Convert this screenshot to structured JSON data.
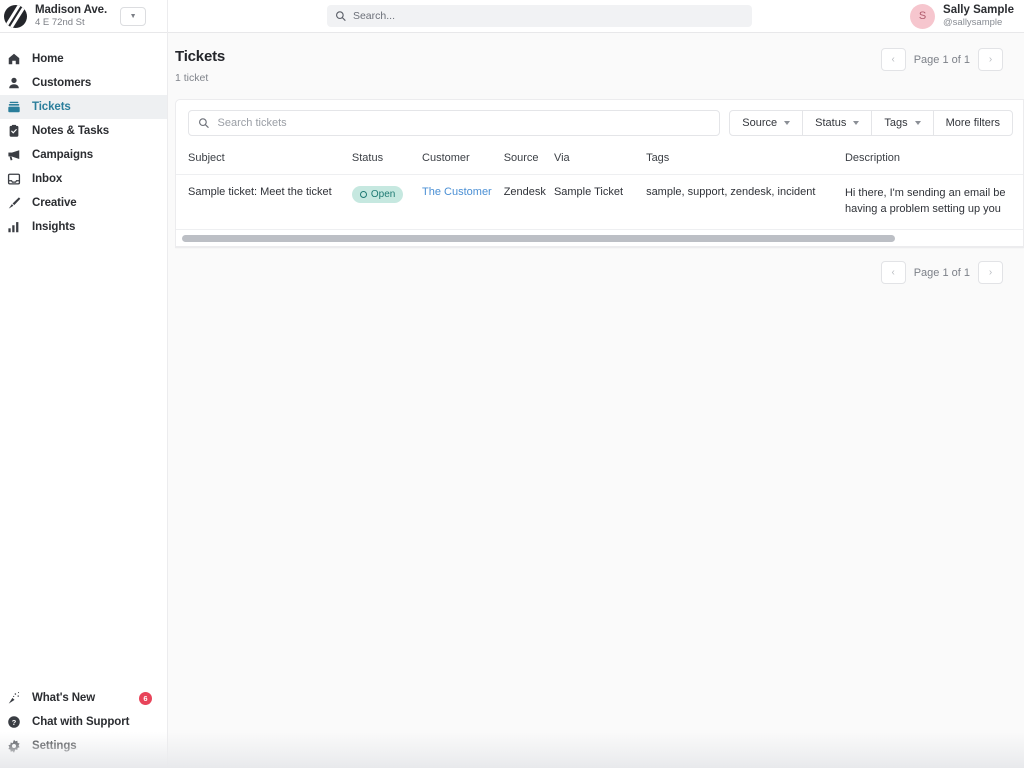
{
  "topbar": {
    "brand": {
      "name": "Madison Ave.",
      "address": "4 E 72nd St",
      "logo_icon": "stripes-logo-icon",
      "caret_icon": "chevron-down-icon"
    },
    "search": {
      "placeholder": "Search...",
      "value": "",
      "icon": "search-icon"
    },
    "user": {
      "initial": "S",
      "name": "Sally Sample",
      "handle": "@sallysample"
    }
  },
  "sidebar": {
    "items": [
      {
        "label": "Home",
        "icon": "home-icon",
        "active": false
      },
      {
        "label": "Customers",
        "icon": "person-icon",
        "active": false
      },
      {
        "label": "Tickets",
        "icon": "ticket-stack-icon",
        "active": true
      },
      {
        "label": "Notes & Tasks",
        "icon": "clipboard-check-icon",
        "active": false
      },
      {
        "label": "Campaigns",
        "icon": "megaphone-icon",
        "active": false
      },
      {
        "label": "Inbox",
        "icon": "inbox-icon",
        "active": false
      },
      {
        "label": "Creative",
        "icon": "paintbrush-icon",
        "active": false
      },
      {
        "label": "Insights",
        "icon": "bar-chart-icon",
        "active": false
      }
    ],
    "footer": [
      {
        "label": "What's New",
        "icon": "sparkle-icon",
        "badge": "6"
      },
      {
        "label": "Chat with Support",
        "icon": "question-circle-icon",
        "badge": ""
      },
      {
        "label": "Settings",
        "icon": "gear-icon",
        "badge": ""
      }
    ],
    "active_color": "#2a7e9b"
  },
  "main": {
    "title": "Tickets",
    "subtitle": "1 ticket",
    "pagination": {
      "label": "Page 1 of 1",
      "prev_icon": "chevron-left-icon",
      "next_icon": "chevron-right-icon"
    },
    "search": {
      "placeholder": "Search tickets",
      "value": "",
      "icon": "search-icon"
    },
    "filters": [
      {
        "label": "Source",
        "has_caret": true
      },
      {
        "label": "Status",
        "has_caret": true
      },
      {
        "label": "Tags",
        "has_caret": true
      },
      {
        "label": "More filters",
        "has_caret": false
      }
    ],
    "table": {
      "columns": [
        "Subject",
        "Status",
        "Customer",
        "Source",
        "Via",
        "Tags",
        "Description"
      ],
      "rows": [
        {
          "subject": "Sample ticket: Meet the ticket",
          "status": "Open",
          "status_color": "#1f7a73",
          "status_bg": "#c6e8e0",
          "customer": "The Customer",
          "source": "Zendesk",
          "via": "Sample Ticket",
          "tags": "sample, support, zendesk, incident",
          "description": "Hi there, I'm sending an email be having a problem setting up you"
        }
      ]
    }
  }
}
